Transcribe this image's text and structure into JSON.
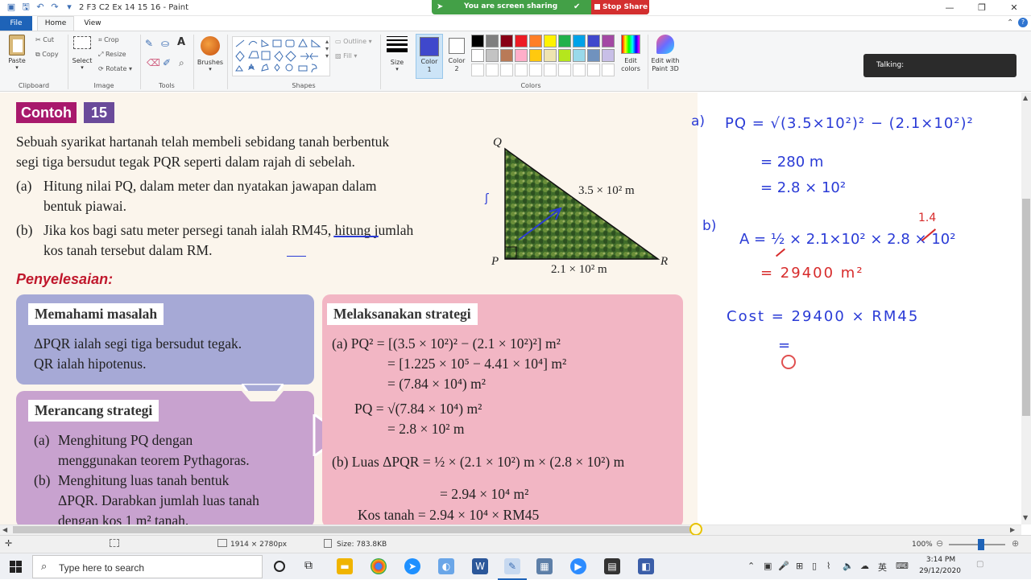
{
  "window": {
    "title": "2 F3 C2 Ex 14 15 16 - Paint",
    "share_text": "You are screen sharing",
    "stop_share": "Stop Share"
  },
  "tabs": {
    "file": "File",
    "home": "Home",
    "view": "View"
  },
  "ribbon": {
    "clipboard": {
      "label": "Clipboard",
      "paste": "Paste",
      "cut": "Cut",
      "copy": "Copy"
    },
    "image": {
      "label": "Image",
      "select": "Select",
      "crop": "Crop",
      "resize": "Resize",
      "rotate": "Rotate"
    },
    "tools": {
      "label": "Tools"
    },
    "brushes": {
      "label": "Brushes"
    },
    "shapes": {
      "label": "Shapes",
      "outline": "Outline",
      "fill": "Fill"
    },
    "size": {
      "label": "Size"
    },
    "color1": {
      "label": "Color 1"
    },
    "color2": {
      "label": "Color 2"
    },
    "colors": {
      "label": "Colors"
    },
    "edit_colors": "Edit colors",
    "edit_paint3d": "Edit with Paint 3D",
    "palette_row1": [
      "#000000",
      "#7f7f7f",
      "#880015",
      "#ed1c24",
      "#ff7f27",
      "#fff200",
      "#22b14c",
      "#00a2e8",
      "#3f48cc",
      "#a349a4"
    ],
    "palette_row2": [
      "#ffffff",
      "#c3c3c3",
      "#b97a57",
      "#ffaec9",
      "#ffc90e",
      "#efe4b0",
      "#b5e61d",
      "#99d9ea",
      "#7092be",
      "#c8bfe7"
    ],
    "color1_value": "#3f48cc"
  },
  "talking": "Talking:",
  "book": {
    "contoh": "Contoh",
    "contoh_num": "15",
    "intro_1": "Sebuah syarikat hartanah telah membeli sebidang tanah berbentuk",
    "intro_2": "segi tiga bersudut tegak PQR seperti dalam rajah di sebelah.",
    "qa_label": "(a)",
    "qa_1": "Hitung nilai PQ, dalam meter dan nyatakan jawapan dalam",
    "qa_2": "bentuk piawai.",
    "qb_label": "(b)",
    "qb_1": "Jika kos bagi satu meter persegi tanah ialah RM45, hitung jumlah",
    "qb_2": "kos tanah tersebut dalam RM.",
    "penyelesaian": "Penyelesaian:",
    "fig": {
      "q": "Q",
      "p": "P",
      "r": "R",
      "hyp": "3.5 × 10² m",
      "base": "2.1 × 10² m"
    },
    "memahami": {
      "head": "Memahami masalah",
      "l1": "ΔPQR ialah segi tiga bersudut tegak.",
      "l2": "QR ialah hipotenus."
    },
    "merancang": {
      "head": "Merancang strategi",
      "a_label": "(a)",
      "a1": "Menghitung PQ dengan",
      "a2": "menggunakan teorem Pythagoras.",
      "b_label": "(b)",
      "b1": "Menghitung luas tanah bentuk",
      "b2": "ΔPQR. Darabkan jumlah luas tanah",
      "b3": "dengan kos 1 m² tanah."
    },
    "melaksanakan": {
      "head": "Melaksanakan strategi",
      "l1": "(a) PQ² = [(3.5 × 10²)² − (2.1 × 10²)²] m²",
      "l2": "= [1.225 × 10⁵ − 4.41 × 10⁴] m²",
      "l3": "= (7.84 × 10⁴) m²",
      "l4": "PQ   = √(7.84 × 10⁴) m²",
      "l5": "= 2.8 × 10² m",
      "l6": "(b) Luas ΔPQR = ½ × (2.1 × 10²) m × (2.8 × 10²) m",
      "l7": "= 2.94 × 10⁴ m²",
      "l8": "Kos tanah   = 2.94 × 10⁴ × RM45"
    }
  },
  "whiteboard": {
    "a_label": "a)",
    "a1": "PQ = √(3.5×10²)² − (2.1×10²)²",
    "a2": "= 280 m",
    "a3": "= 2.8 × 10²",
    "b_label": "b)",
    "b1": "A = ½ × 2.1×10² × 2.8 × 10²",
    "b_over": "1.4",
    "b2": "= 29400 m²",
    "c1": "Cost = 29400 × RM45",
    "c2": "="
  },
  "status": {
    "dimensions": "1914 × 2780px",
    "size": "Size: 783.8KB",
    "zoom": "100%"
  },
  "taskbar": {
    "search_placeholder": "Type here to search",
    "time": "3:14 PM",
    "date": "29/12/2020",
    "lang": "英"
  },
  "colors": {
    "accent": "#1e63b8",
    "share_green": "#43a047",
    "stop_red": "#d32f2f",
    "contoh_magenta": "#a8196c",
    "ink_blue": "#2a3bd6"
  }
}
